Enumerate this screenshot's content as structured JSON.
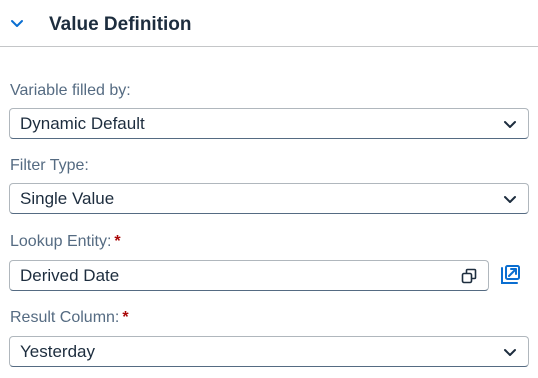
{
  "section": {
    "title": "Value Definition",
    "expanded": true
  },
  "fields": {
    "variable_filled_by": {
      "label": "Variable filled by:",
      "value": "Dynamic Default",
      "required": false
    },
    "filter_type": {
      "label": "Filter Type:",
      "value": "Single Value",
      "required": false
    },
    "lookup_entity": {
      "label": "Lookup Entity:",
      "value": "Derived Date",
      "required": true,
      "required_mark": "*"
    },
    "result_column": {
      "label": "Result Column:",
      "value": "Yesterday",
      "required": true,
      "required_mark": "*"
    }
  },
  "icons": {
    "collapse": "chevron-down-icon",
    "dropdown": "chevron-down-icon",
    "value_help": "value-help-icon",
    "open_entity": "open-link-icon"
  },
  "colors": {
    "accent": "#0a6ed1",
    "label": "#556b82",
    "text": "#1d2d3e",
    "required": "#aa0808",
    "border": "#b0b7bd"
  }
}
